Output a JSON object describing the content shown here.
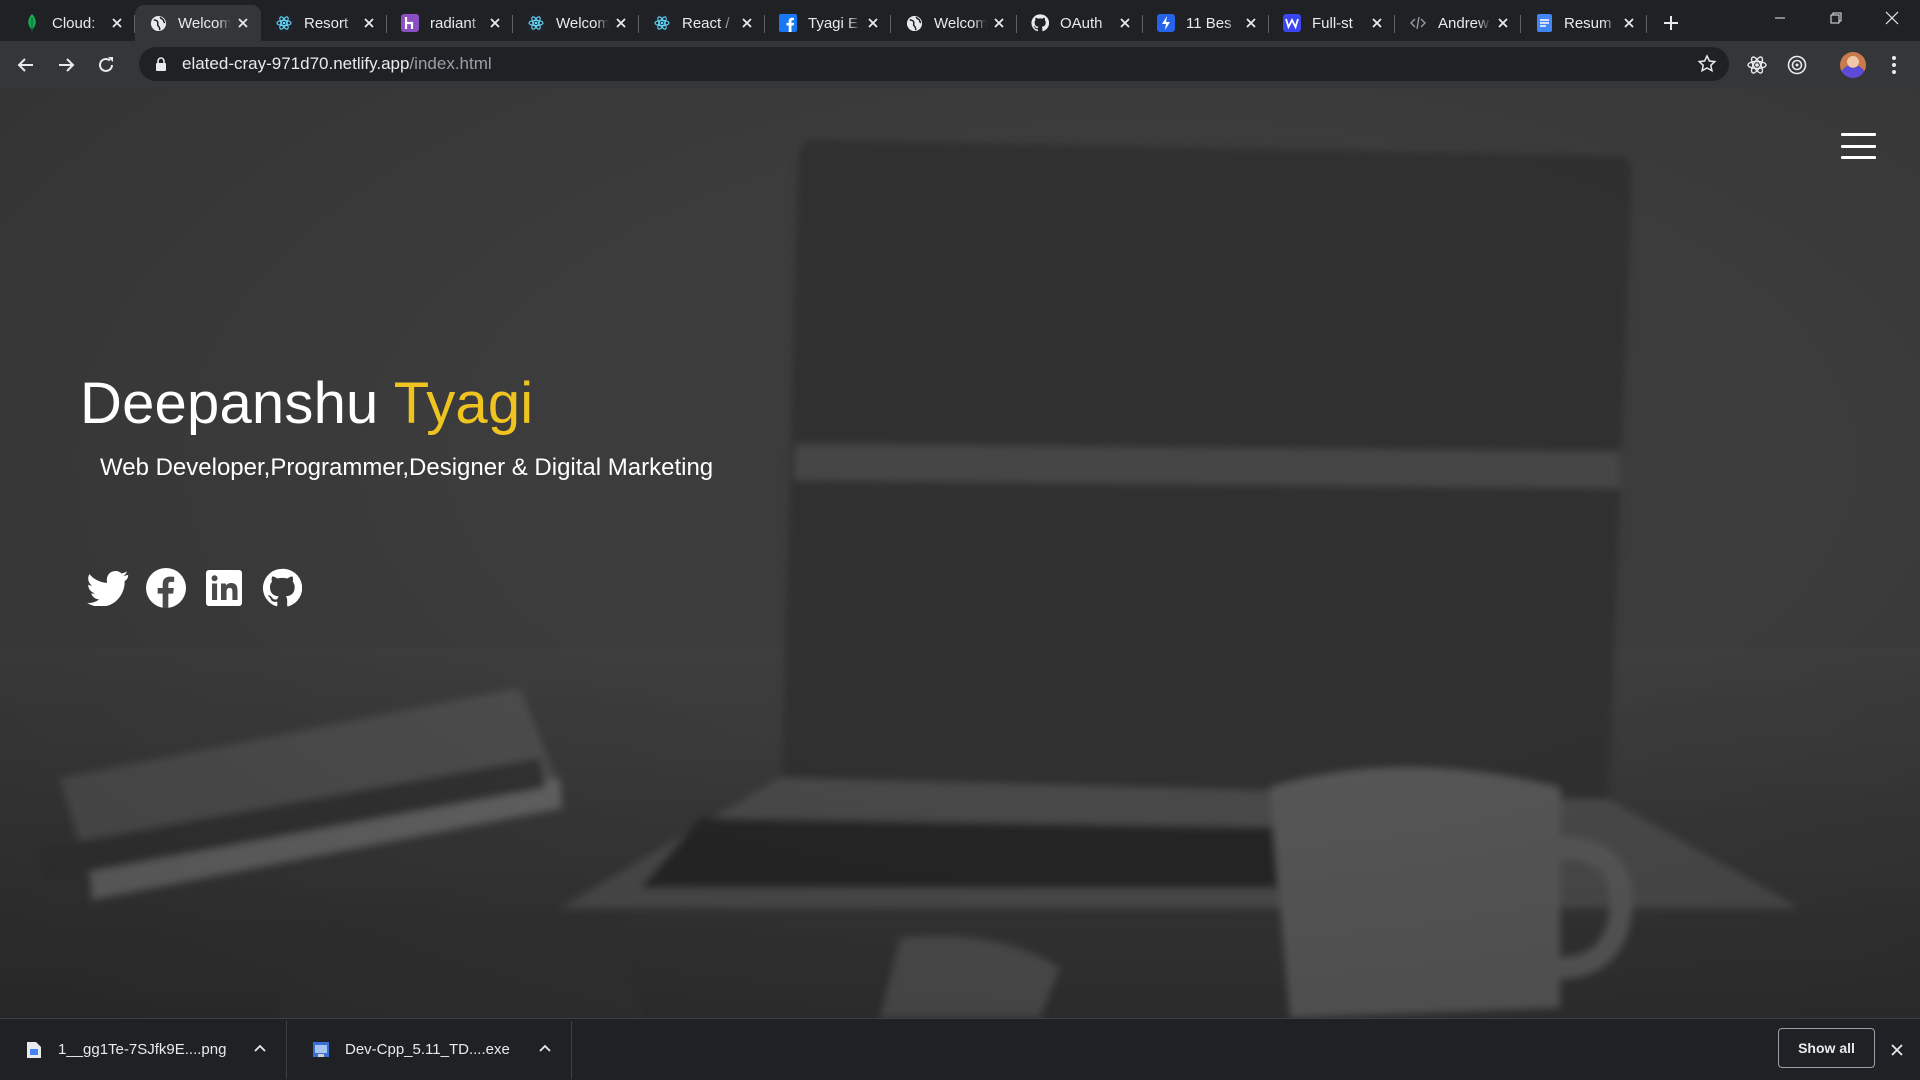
{
  "browser": {
    "tabs": [
      {
        "title": "Cloud:",
        "icon": "leaf-icon",
        "color": "#13aa52",
        "active": false
      },
      {
        "title": "Welcome",
        "icon": "globe-icon",
        "color": "#e8eaed",
        "active": true
      },
      {
        "title": "Resort",
        "icon": "react-icon",
        "color": "#61dafb",
        "active": false
      },
      {
        "title": "radiant",
        "icon": "h-logo-icon",
        "color": "#8a4fc3",
        "active": false
      },
      {
        "title": "Welcome",
        "icon": "react-icon",
        "color": "#61dafb",
        "active": false
      },
      {
        "title": "React /",
        "icon": "react-icon",
        "color": "#61dafb",
        "active": false
      },
      {
        "title": "Tyagi E",
        "icon": "facebook-icon",
        "color": "#1877f2",
        "active": false
      },
      {
        "title": "Welcome",
        "icon": "globe-icon",
        "color": "#e8eaed",
        "active": false
      },
      {
        "title": "OAuth",
        "icon": "github-icon",
        "color": "#e8eaed",
        "active": false
      },
      {
        "title": "11 Bes",
        "icon": "bolt-icon",
        "color": "#2563eb",
        "active": false
      },
      {
        "title": "Full-st",
        "icon": "w-logo-icon",
        "color": "#3b45f0",
        "active": false
      },
      {
        "title": "Andrew",
        "icon": "code-icon",
        "color": "#9aa0a6",
        "active": false
      },
      {
        "title": "Resum",
        "icon": "docs-icon",
        "color": "#4285f4",
        "active": false
      }
    ],
    "address": {
      "host": "elated-cray-971d70.netlify.app",
      "path": "/index.html"
    }
  },
  "page": {
    "name_first": "Deepanshu",
    "name_last": "Tyagi",
    "subtitle": "Web Developer,Programmer,Designer & Digital Marketing",
    "accent_color": "#f0c420",
    "socials": [
      "twitter-icon",
      "facebook-icon",
      "linkedin-icon",
      "github-icon"
    ]
  },
  "downloads": {
    "items": [
      {
        "name": "1__gg1Te-7SJfk9E....png",
        "icon": "image-file-icon"
      },
      {
        "name": "Dev-Cpp_5.11_TD....exe",
        "icon": "exe-file-icon"
      }
    ],
    "show_all_label": "Show all"
  }
}
